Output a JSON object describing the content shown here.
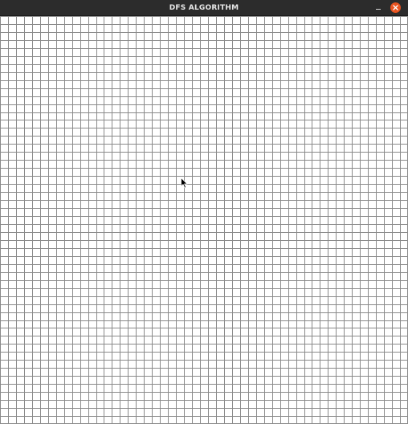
{
  "window": {
    "title": "DFS ALGORITHM",
    "controls": {
      "minimize_icon": "minimize-icon",
      "close_icon": "close-icon"
    }
  },
  "grid": {
    "rows": 51,
    "cols": 51,
    "line_color": "#8a8a8a",
    "background": "#ffffff"
  },
  "colors": {
    "titlebar": "#2c2c2c",
    "title_text": "#e8e8e8",
    "close_button": "#e95420"
  }
}
